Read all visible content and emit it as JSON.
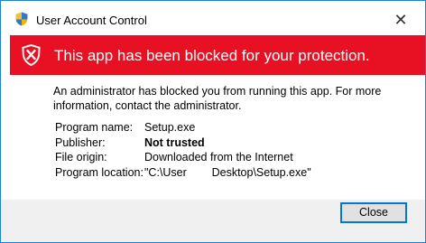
{
  "window": {
    "title": "User Account Control",
    "close_glyph": "✕"
  },
  "banner": {
    "text": "This app has been blocked for your protection.",
    "color": "#e81123",
    "icon": "shield-x-icon"
  },
  "message": "An administrator has blocked you from running this app. For more information, contact the administrator.",
  "details": {
    "program_name": {
      "label": "Program name:",
      "value": "Setup.exe"
    },
    "publisher": {
      "label": "Publisher:",
      "value": "Not trusted"
    },
    "file_origin": {
      "label": "File origin:",
      "value": "Downloaded from the Internet"
    },
    "program_location": {
      "label": "Program location:",
      "value": "\"C:\\User        Desktop\\Setup.exe\""
    }
  },
  "footer": {
    "close_label": "Close"
  },
  "colors": {
    "accent": "#0078d7",
    "footer_bg": "#f0f0f0"
  }
}
